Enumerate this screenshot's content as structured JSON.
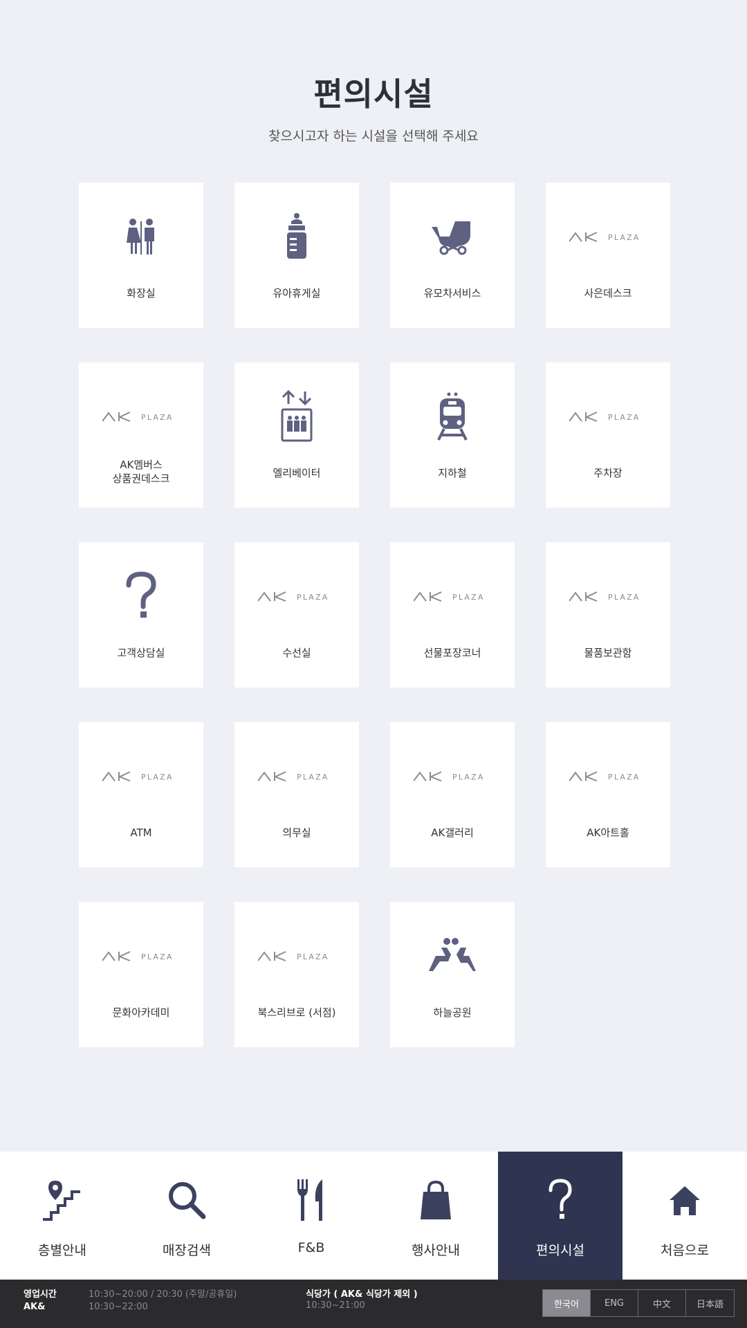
{
  "header": {
    "title": "편의시설",
    "subtitle": "찾으시고자 하는 시설을 선택해 주세요"
  },
  "brand_logo_text": "AK PLAZA",
  "facilities": [
    {
      "label": "화장실",
      "icon": "restroom-icon"
    },
    {
      "label": "유아휴게실",
      "icon": "baby-bottle-icon"
    },
    {
      "label": "유모차서비스",
      "icon": "stroller-icon"
    },
    {
      "label": "사은데스크",
      "icon": "ak-plaza-logo"
    },
    {
      "label": "AK멤버스\n상품권데스크",
      "icon": "ak-plaza-logo"
    },
    {
      "label": "엘리베이터",
      "icon": "elevator-icon"
    },
    {
      "label": "지하철",
      "icon": "subway-icon"
    },
    {
      "label": "주차장",
      "icon": "ak-plaza-logo"
    },
    {
      "label": "고객상담실",
      "icon": "question-icon"
    },
    {
      "label": "수선실",
      "icon": "ak-plaza-logo"
    },
    {
      "label": "선물포장코너",
      "icon": "ak-plaza-logo"
    },
    {
      "label": "물품보관함",
      "icon": "ak-plaza-logo"
    },
    {
      "label": "ATM",
      "icon": "ak-plaza-logo"
    },
    {
      "label": "의무실",
      "icon": "ak-plaza-logo"
    },
    {
      "label": "AK갤러리",
      "icon": "ak-plaza-logo"
    },
    {
      "label": "AK아트홀",
      "icon": "ak-plaza-logo"
    },
    {
      "label": "문화아카데미",
      "icon": "ak-plaza-logo"
    },
    {
      "label": "북스리브로 (서점)",
      "icon": "ak-plaza-logo"
    },
    {
      "label": "하늘공원",
      "icon": "rooftop-park-icon"
    }
  ],
  "nav": [
    {
      "label": "층별안내",
      "icon": "floor-stairs-icon",
      "active": false
    },
    {
      "label": "매장검색",
      "icon": "search-icon",
      "active": false
    },
    {
      "label": "F&B",
      "icon": "fork-knife-icon",
      "active": false
    },
    {
      "label": "행사안내",
      "icon": "shopping-bag-icon",
      "active": false
    },
    {
      "label": "편의시설",
      "icon": "question-icon",
      "active": true
    },
    {
      "label": "처음으로",
      "icon": "home-icon",
      "active": false
    }
  ],
  "footer": {
    "hours_label": "영업시간",
    "hours_value": "10:30~20:00 / 20:30 (주말/공휴일)",
    "ak_label": "AK&",
    "ak_value": "10:30~22:00",
    "food_label": "식당가 ( AK& 식당가 제외 )",
    "food_value": "10:30~21:00"
  },
  "languages": [
    {
      "label": "한국어",
      "active": true
    },
    {
      "label": "ENG",
      "active": false
    },
    {
      "label": "中文",
      "active": false
    },
    {
      "label": "日本語",
      "active": false
    }
  ],
  "colors": {
    "background": "#eef0f5",
    "icon": "#5e6180",
    "nav_icon": "#3d4160",
    "nav_active": "#2f3550",
    "footer": "#2b2b2d"
  }
}
